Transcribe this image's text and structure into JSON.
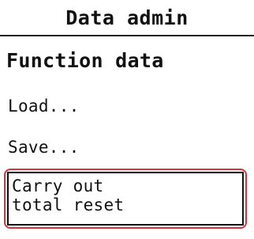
{
  "window": {
    "title": "Data admin"
  },
  "section": {
    "title": "Function data"
  },
  "menu": {
    "items": [
      {
        "label": "Load..."
      },
      {
        "label": "Save..."
      }
    ],
    "selected": {
      "line1": "Carry out",
      "line2": "total reset"
    }
  },
  "colors": {
    "highlight": "#d8343f",
    "text": "#111111",
    "background": "#ffffff"
  }
}
